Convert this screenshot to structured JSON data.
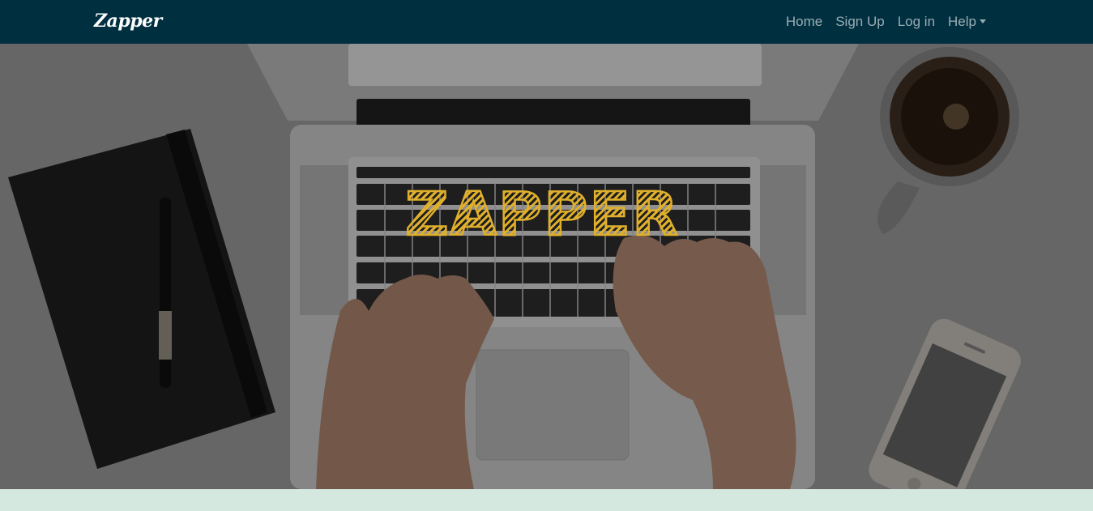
{
  "navbar": {
    "brand": "Zapper",
    "links": {
      "home": "Home",
      "signup": "Sign Up",
      "login": "Log in",
      "help": "Help"
    }
  },
  "hero": {
    "title": "Zapper"
  },
  "colors": {
    "navbar_bg": "#002f3f",
    "accent_gold": "#e0b02c",
    "footer_strip": "#d4e8df"
  },
  "icons": {
    "help_dropdown": "caret-down-icon"
  }
}
